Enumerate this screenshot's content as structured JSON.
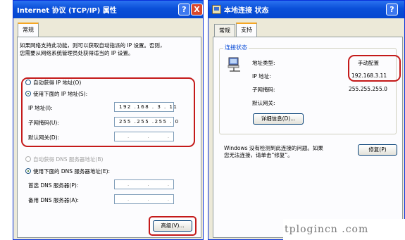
{
  "left_window": {
    "title": "Internet 协议 (TCP/IP) 属性",
    "help_glyph": "?",
    "close_glyph": "X",
    "tab_general": "常规",
    "description_line1": "如果网络支持此功能，则可以获取自动指派的 IP 设置。否则，",
    "description_line2": "您需要从网络系统管理员处获得适当的 IP 设置。",
    "radio_auto_ip": "自动获得 IP 地址(O)",
    "radio_manual_ip": "使用下面的 IP 地址(S):",
    "label_ip": "IP 地址(I):",
    "value_ip": "192 .168 . 3 . 11",
    "label_mask": "子网掩码(U):",
    "value_mask": "255 .255 .255 . 0",
    "label_gateway": "默认网关(D):",
    "value_gateway": ". . .",
    "radio_auto_dns": "自动获得 DNS 服务器地址(B)",
    "radio_manual_dns": "使用下面的 DNS 服务器地址(E):",
    "label_dns1": "首选 DNS 服务器(P):",
    "value_dns1": ". . .",
    "label_dns2": "备用 DNS 服务器(A):",
    "value_dns2": ". . .",
    "advanced_button": "高级(V)..."
  },
  "right_window": {
    "title": "本地连接 状态",
    "help_glyph": "?",
    "tab_general": "常规",
    "tab_support": "支持",
    "group_title": "连接状态",
    "label_addr_type": "地址类型:",
    "value_addr_type": "手动配置",
    "label_ip": "IP 地址:",
    "value_ip": "192.168.3.11",
    "label_mask": "子网掩码:",
    "value_mask": "255.255.255.0",
    "label_gateway": "默认网关:",
    "details_button": "详细信息(D)...",
    "message_line1": "Windows 没有检测到此连接的问题。如果",
    "message_line2": "您无法连接，请单击“修复”。",
    "repair_button": "修复(P)"
  },
  "watermark": "tplogincn .com",
  "colors": {
    "annotation_red": "#c41a1a",
    "titlebar_blue": "#0a4fd8"
  }
}
